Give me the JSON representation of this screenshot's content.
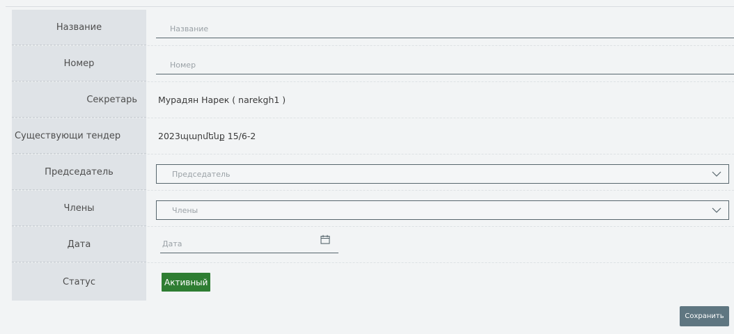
{
  "form": {
    "name": {
      "label": "Название",
      "placeholder": "Название",
      "value": ""
    },
    "number": {
      "label": "Номер",
      "placeholder": "Номер",
      "value": ""
    },
    "secretary": {
      "label": "Секретарь",
      "value": "Мурадян Нарек ( narekgh1 )"
    },
    "existing_tender": {
      "label": "Существующи тендер",
      "value": "2023պարմենք 15/6-2"
    },
    "chairman": {
      "label": "Председатель",
      "placeholder": "Председатель",
      "icon": "chevron-down-icon"
    },
    "members": {
      "label": "Члены",
      "placeholder": "Члены",
      "icon": "chevron-down-icon"
    },
    "date": {
      "label": "Дата",
      "placeholder": "Дата",
      "icon": "calendar-icon"
    },
    "status": {
      "label": "Статус",
      "value": "Активный",
      "color": "#2e7d32"
    }
  },
  "actions": {
    "save_label": "Сохранить",
    "save_color": "#5f7681"
  }
}
